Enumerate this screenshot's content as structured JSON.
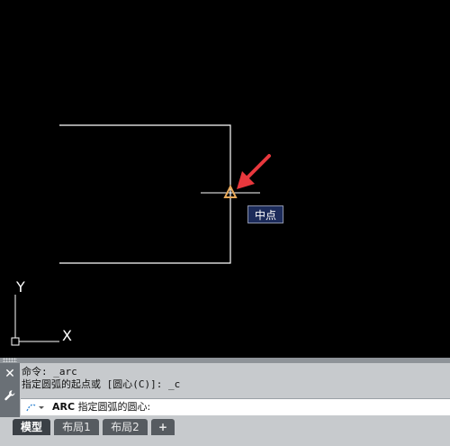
{
  "snap_tooltip": "中点",
  "ucs": {
    "x_label": "X",
    "y_label": "Y"
  },
  "command": {
    "history": [
      "命令: _arc",
      "指定圆弧的起点或 [圆心(C)]: _c"
    ],
    "prompt_keyword": "ARC",
    "prompt_text": "指定圆弧的圆心:",
    "close_icon": "close-icon",
    "customize_icon": "wrench-icon"
  },
  "tabs": {
    "model": "模型",
    "layout1": "布局1",
    "layout2": "布局2",
    "add": "+"
  },
  "colors": {
    "background": "#000000",
    "lines": "#ffffff",
    "snap_marker": "#e8a95a",
    "arrow": "#e8383d",
    "tooltip_bg": "#1c2b5a"
  }
}
